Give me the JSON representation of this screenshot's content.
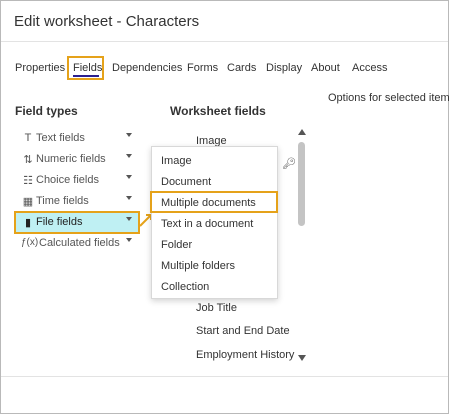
{
  "window": {
    "title": "Edit worksheet - Characters"
  },
  "tabs": [
    {
      "label": "Properties"
    },
    {
      "label": "Fields"
    },
    {
      "label": "Dependencies"
    },
    {
      "label": "Forms"
    },
    {
      "label": "Cards"
    },
    {
      "label": "Display"
    },
    {
      "label": "About"
    },
    {
      "label": "Access"
    }
  ],
  "active_tab": "Fields",
  "options_panel": {
    "label": "Options for selected item"
  },
  "field_types": {
    "heading": "Field types",
    "items": [
      {
        "label": "Text fields",
        "icon": "text-T-icon"
      },
      {
        "label": "Numeric fields",
        "icon": "numeric-arrows-icon"
      },
      {
        "label": "Choice fields",
        "icon": "list-icon"
      },
      {
        "label": "Time fields",
        "icon": "calendar-icon"
      },
      {
        "label": "File fields",
        "icon": "file-icon"
      },
      {
        "label": "Calculated fields",
        "icon": "function-icon"
      }
    ],
    "selected": "File fields"
  },
  "worksheet_fields": {
    "heading": "Worksheet fields",
    "items": [
      {
        "label": "Image"
      },
      {
        "label": "Job Title"
      },
      {
        "label": "Start and End Date"
      },
      {
        "label": "Employment History"
      }
    ]
  },
  "file_fields_menu": {
    "items": [
      {
        "label": "Image"
      },
      {
        "label": "Document"
      },
      {
        "label": "Multiple documents"
      },
      {
        "label": "Text in a document"
      },
      {
        "label": "Folder"
      },
      {
        "label": "Multiple folders"
      },
      {
        "label": "Collection"
      }
    ],
    "highlighted": "Multiple documents"
  },
  "colors": {
    "highlight_box": "#e5a21a",
    "active_tab_underline": "#2a1f8f",
    "selected_row_bg": "#bff0f3"
  }
}
